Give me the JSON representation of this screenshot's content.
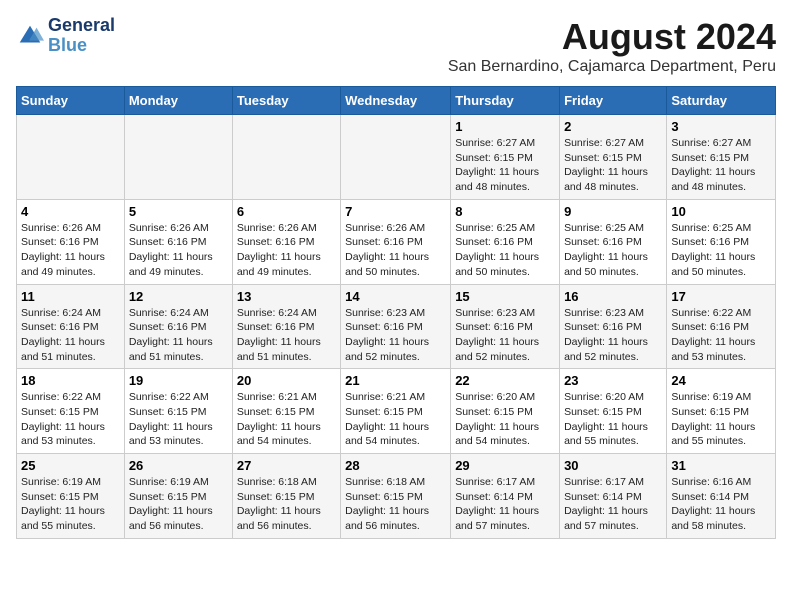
{
  "logo": {
    "line1": "General",
    "line2": "Blue"
  },
  "title": "August 2024",
  "subtitle": "San Bernardino, Cajamarca Department, Peru",
  "days_of_week": [
    "Sunday",
    "Monday",
    "Tuesday",
    "Wednesday",
    "Thursday",
    "Friday",
    "Saturday"
  ],
  "weeks": [
    [
      {
        "day": "",
        "info": ""
      },
      {
        "day": "",
        "info": ""
      },
      {
        "day": "",
        "info": ""
      },
      {
        "day": "",
        "info": ""
      },
      {
        "day": "1",
        "info": "Sunrise: 6:27 AM\nSunset: 6:15 PM\nDaylight: 11 hours\nand 48 minutes."
      },
      {
        "day": "2",
        "info": "Sunrise: 6:27 AM\nSunset: 6:15 PM\nDaylight: 11 hours\nand 48 minutes."
      },
      {
        "day": "3",
        "info": "Sunrise: 6:27 AM\nSunset: 6:15 PM\nDaylight: 11 hours\nand 48 minutes."
      }
    ],
    [
      {
        "day": "4",
        "info": "Sunrise: 6:26 AM\nSunset: 6:16 PM\nDaylight: 11 hours\nand 49 minutes."
      },
      {
        "day": "5",
        "info": "Sunrise: 6:26 AM\nSunset: 6:16 PM\nDaylight: 11 hours\nand 49 minutes."
      },
      {
        "day": "6",
        "info": "Sunrise: 6:26 AM\nSunset: 6:16 PM\nDaylight: 11 hours\nand 49 minutes."
      },
      {
        "day": "7",
        "info": "Sunrise: 6:26 AM\nSunset: 6:16 PM\nDaylight: 11 hours\nand 50 minutes."
      },
      {
        "day": "8",
        "info": "Sunrise: 6:25 AM\nSunset: 6:16 PM\nDaylight: 11 hours\nand 50 minutes."
      },
      {
        "day": "9",
        "info": "Sunrise: 6:25 AM\nSunset: 6:16 PM\nDaylight: 11 hours\nand 50 minutes."
      },
      {
        "day": "10",
        "info": "Sunrise: 6:25 AM\nSunset: 6:16 PM\nDaylight: 11 hours\nand 50 minutes."
      }
    ],
    [
      {
        "day": "11",
        "info": "Sunrise: 6:24 AM\nSunset: 6:16 PM\nDaylight: 11 hours\nand 51 minutes."
      },
      {
        "day": "12",
        "info": "Sunrise: 6:24 AM\nSunset: 6:16 PM\nDaylight: 11 hours\nand 51 minutes."
      },
      {
        "day": "13",
        "info": "Sunrise: 6:24 AM\nSunset: 6:16 PM\nDaylight: 11 hours\nand 51 minutes."
      },
      {
        "day": "14",
        "info": "Sunrise: 6:23 AM\nSunset: 6:16 PM\nDaylight: 11 hours\nand 52 minutes."
      },
      {
        "day": "15",
        "info": "Sunrise: 6:23 AM\nSunset: 6:16 PM\nDaylight: 11 hours\nand 52 minutes."
      },
      {
        "day": "16",
        "info": "Sunrise: 6:23 AM\nSunset: 6:16 PM\nDaylight: 11 hours\nand 52 minutes."
      },
      {
        "day": "17",
        "info": "Sunrise: 6:22 AM\nSunset: 6:16 PM\nDaylight: 11 hours\nand 53 minutes."
      }
    ],
    [
      {
        "day": "18",
        "info": "Sunrise: 6:22 AM\nSunset: 6:15 PM\nDaylight: 11 hours\nand 53 minutes."
      },
      {
        "day": "19",
        "info": "Sunrise: 6:22 AM\nSunset: 6:15 PM\nDaylight: 11 hours\nand 53 minutes."
      },
      {
        "day": "20",
        "info": "Sunrise: 6:21 AM\nSunset: 6:15 PM\nDaylight: 11 hours\nand 54 minutes."
      },
      {
        "day": "21",
        "info": "Sunrise: 6:21 AM\nSunset: 6:15 PM\nDaylight: 11 hours\nand 54 minutes."
      },
      {
        "day": "22",
        "info": "Sunrise: 6:20 AM\nSunset: 6:15 PM\nDaylight: 11 hours\nand 54 minutes."
      },
      {
        "day": "23",
        "info": "Sunrise: 6:20 AM\nSunset: 6:15 PM\nDaylight: 11 hours\nand 55 minutes."
      },
      {
        "day": "24",
        "info": "Sunrise: 6:19 AM\nSunset: 6:15 PM\nDaylight: 11 hours\nand 55 minutes."
      }
    ],
    [
      {
        "day": "25",
        "info": "Sunrise: 6:19 AM\nSunset: 6:15 PM\nDaylight: 11 hours\nand 55 minutes."
      },
      {
        "day": "26",
        "info": "Sunrise: 6:19 AM\nSunset: 6:15 PM\nDaylight: 11 hours\nand 56 minutes."
      },
      {
        "day": "27",
        "info": "Sunrise: 6:18 AM\nSunset: 6:15 PM\nDaylight: 11 hours\nand 56 minutes."
      },
      {
        "day": "28",
        "info": "Sunrise: 6:18 AM\nSunset: 6:15 PM\nDaylight: 11 hours\nand 56 minutes."
      },
      {
        "day": "29",
        "info": "Sunrise: 6:17 AM\nSunset: 6:14 PM\nDaylight: 11 hours\nand 57 minutes."
      },
      {
        "day": "30",
        "info": "Sunrise: 6:17 AM\nSunset: 6:14 PM\nDaylight: 11 hours\nand 57 minutes."
      },
      {
        "day": "31",
        "info": "Sunrise: 6:16 AM\nSunset: 6:14 PM\nDaylight: 11 hours\nand 58 minutes."
      }
    ]
  ]
}
